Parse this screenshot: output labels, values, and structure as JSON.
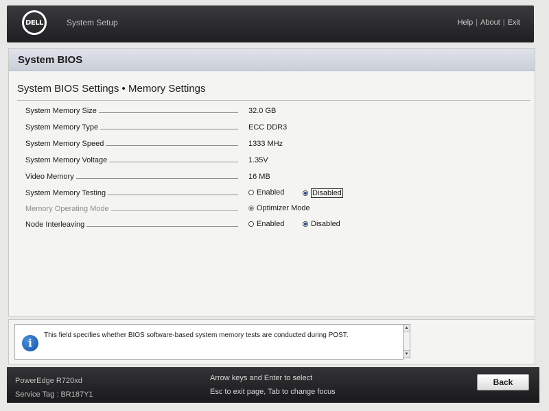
{
  "header": {
    "logo_text": "DELL",
    "title": "System Setup",
    "links": [
      "Help",
      "About",
      "Exit"
    ],
    "separator": "|"
  },
  "section": {
    "title": "System BIOS"
  },
  "page": {
    "title": "System BIOS Settings • Memory Settings"
  },
  "settings": [
    {
      "label": "System Memory Size",
      "value": "32.0 GB"
    },
    {
      "label": "System Memory Type",
      "value": "ECC DDR3"
    },
    {
      "label": "System Memory Speed",
      "value": "1333 MHz"
    },
    {
      "label": "System Memory Voltage",
      "value": "1.35V"
    },
    {
      "label": "Video Memory",
      "value": "16 MB"
    },
    {
      "label": "System Memory Testing",
      "options": [
        "Enabled",
        "Disabled"
      ],
      "selected": "Disabled"
    },
    {
      "label": "Memory Operating Mode",
      "options": [
        "Optimizer Mode"
      ],
      "selected": "Optimizer Mode",
      "disabled": true
    },
    {
      "label": "Node Interleaving",
      "options": [
        "Enabled",
        "Disabled"
      ],
      "selected": "Disabled"
    }
  ],
  "help": {
    "icon": "info-icon",
    "icon_glyph": "i",
    "text": "This field specifies whether BIOS software-based system memory tests are conducted during POST."
  },
  "footer": {
    "model": "PowerEdge R720xd",
    "service_tag": "Service Tag : BR187Y1",
    "hint_line1": "Arrow keys and Enter to select",
    "hint_line2": "Esc to exit page, Tab to change focus",
    "back_label": "Back"
  },
  "colors": {
    "header_bg": "#2a2a2c",
    "section_bar": "#c9ced8",
    "radio_selected": "#1f3f8f",
    "info_icon": "#1352a8"
  }
}
